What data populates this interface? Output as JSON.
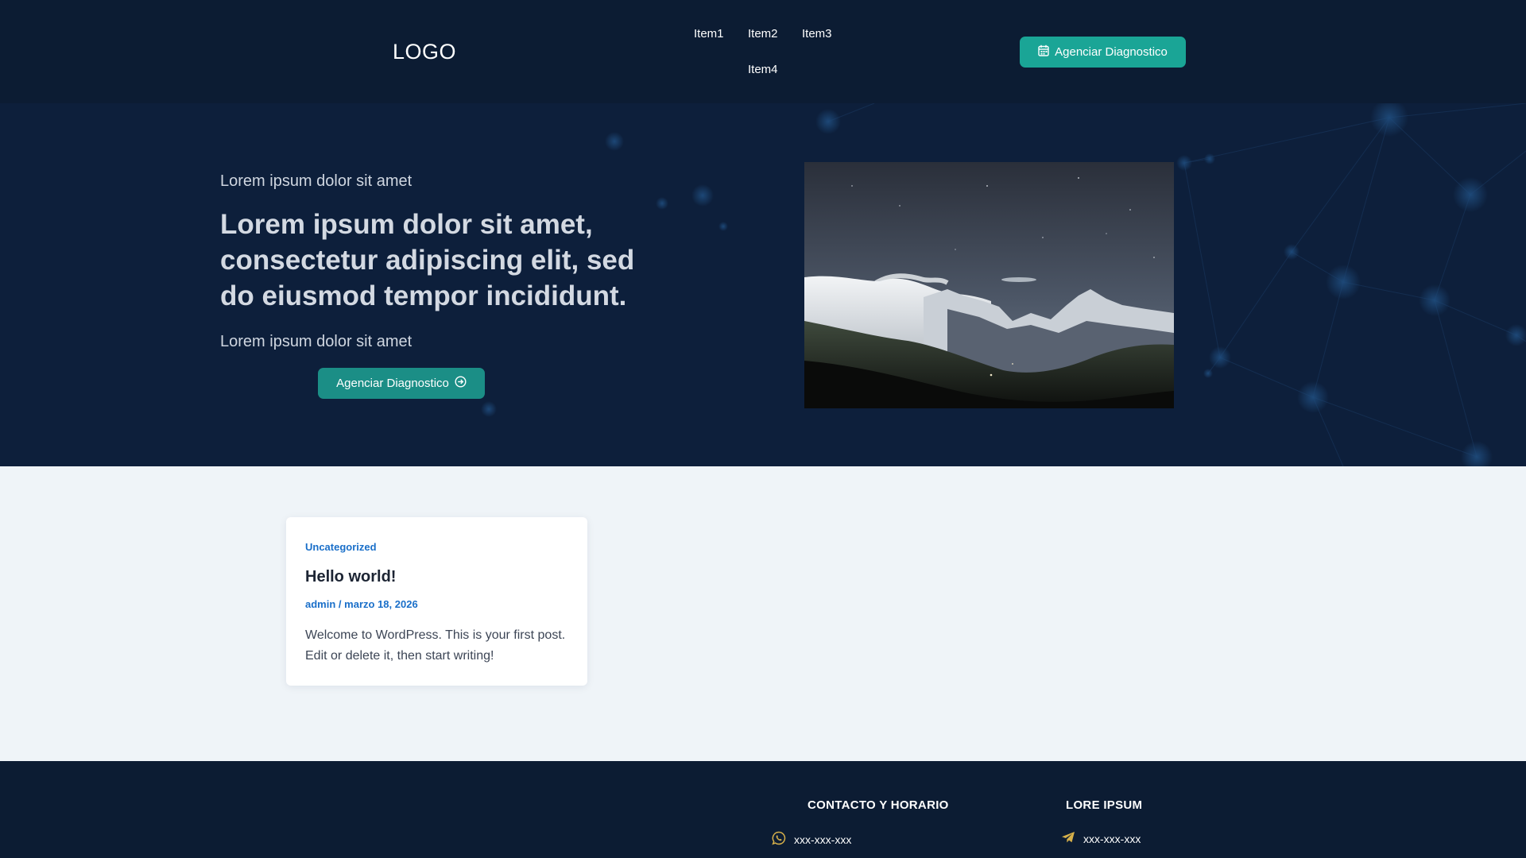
{
  "header": {
    "logo": "LOGO",
    "nav": [
      "Item1",
      "Item2",
      "Item3",
      "Item4"
    ],
    "cta_label": "Agenciar Diagnostico",
    "cta_icon": "calendar-icon"
  },
  "hero": {
    "eyebrow": "Lorem ipsum dolor sit amet",
    "title": "Lorem ipsum dolor sit amet, consectetur adipiscing elit, sed do eiusmod tempor incididunt.",
    "subtitle": "Lorem ipsum dolor sit amet",
    "cta_label": "Agenciar Diagnostico",
    "cta_icon": "arrow-circle-right-icon",
    "image": "mountain-night-sky-photo"
  },
  "posts": [
    {
      "category": "Uncategorized",
      "title": "Hello world!",
      "author": "admin",
      "separator": "/",
      "date": "marzo 18, 2026",
      "excerpt": "Welcome to WordPress. This is your first post. Edit or delete it, then start writing!"
    }
  ],
  "footer": {
    "contact_heading": "CONTACTO Y HORARIO",
    "contact_phone": "xxx-xxx-xxx",
    "contact_icon": "whatsapp-icon",
    "lore_heading": "LORE IPSUM",
    "lore_phone": "xxx-xxx-xxx",
    "lore_icon": "telegram-icon"
  },
  "colors": {
    "header_bg": "#0c1c33",
    "hero_bg": "#0d1f3b",
    "accent": "#1aa596",
    "link": "#1a6fc9",
    "footer_icon": "#d6b04a"
  }
}
